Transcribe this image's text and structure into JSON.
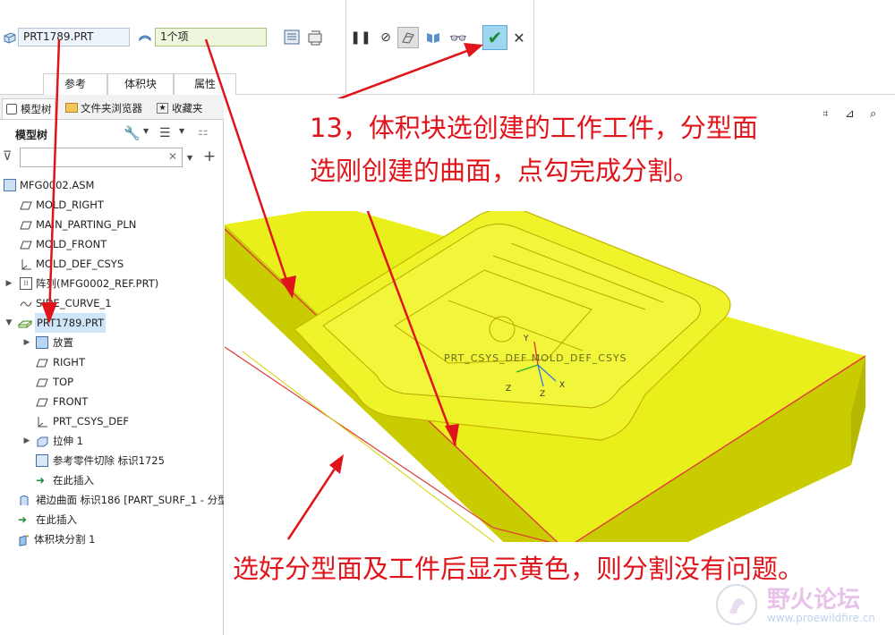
{
  "dashboard": {
    "workpiece_value": "PRT1789.PRT",
    "quilt_value": "1个项",
    "tabs": [
      "参考",
      "体积块",
      "属性"
    ],
    "icons": [
      "pause-icon",
      "stop-icon",
      "preview-icon",
      "verify-icon",
      "glasses-icon",
      "ok-check-icon",
      "close-icon"
    ]
  },
  "model_tree": {
    "tabs": [
      "模型树",
      "文件夹浏览器",
      "收藏夹"
    ],
    "title": "模型树",
    "filter_placeholder": "",
    "items": [
      {
        "label": "MFG0002.ASM",
        "icon": "assembly-icon"
      },
      {
        "label": "MOLD_RIGHT",
        "icon": "datum-plane-icon"
      },
      {
        "label": "MAIN_PARTING_PLN",
        "icon": "datum-plane-icon"
      },
      {
        "label": "MOLD_FRONT",
        "icon": "datum-plane-icon"
      },
      {
        "label": "MOLD_DEF_CSYS",
        "icon": "csys-icon"
      },
      {
        "label": "阵列(MFG0002_REF.PRT)",
        "icon": "pattern-icon"
      },
      {
        "label": "SIDE_CURVE_1",
        "icon": "curve-icon"
      },
      {
        "label": "PRT1789.PRT",
        "icon": "part-icon"
      },
      {
        "label": "放置",
        "icon": "placement-icon"
      },
      {
        "label": "RIGHT",
        "icon": "datum-plane-icon"
      },
      {
        "label": "TOP",
        "icon": "datum-plane-icon"
      },
      {
        "label": "FRONT",
        "icon": "datum-plane-icon"
      },
      {
        "label": "PRT_CSYS_DEF",
        "icon": "csys-icon"
      },
      {
        "label": "拉伸 1",
        "icon": "extrude-icon"
      },
      {
        "label": "参考零件切除 标识1725",
        "icon": "cut-icon"
      },
      {
        "label": "在此插入",
        "icon": "insert-here-icon"
      },
      {
        "label": "裙边曲面 标识186 [PART_SURF_1 - 分型",
        "icon": "skirt-surface-icon"
      },
      {
        "label": "在此插入",
        "icon": "insert-here-icon"
      },
      {
        "label": "体积块分割 1",
        "icon": "volume-split-icon"
      }
    ]
  },
  "graphics": {
    "csys_label": "PRT_CSYS_DEF",
    "overlap_label": "PRT_CSYS_DEF MOLD_DEF_CSYS",
    "axis_labels": [
      "Y",
      "Z",
      "X",
      "Z",
      "X"
    ]
  },
  "annotations": {
    "callout_13_line1": "13，体积块选创建的工作工件，分型面",
    "callout_13_line2": "选刚创建的曲面，点勾完成分割。",
    "callout_yellow": "选好分型面及工件后显示黄色，则分割没有问题。"
  },
  "watermark": {
    "site_name": "野火论坛",
    "url": "www.proewildfire.cn"
  },
  "colors": {
    "annotation_red": "#e0141a",
    "workpiece_yellow": "#e8ef00",
    "edge_red": "#e23b3b",
    "selection_blue": "#cfe6f8",
    "ok_button": "#9fd7f1"
  }
}
